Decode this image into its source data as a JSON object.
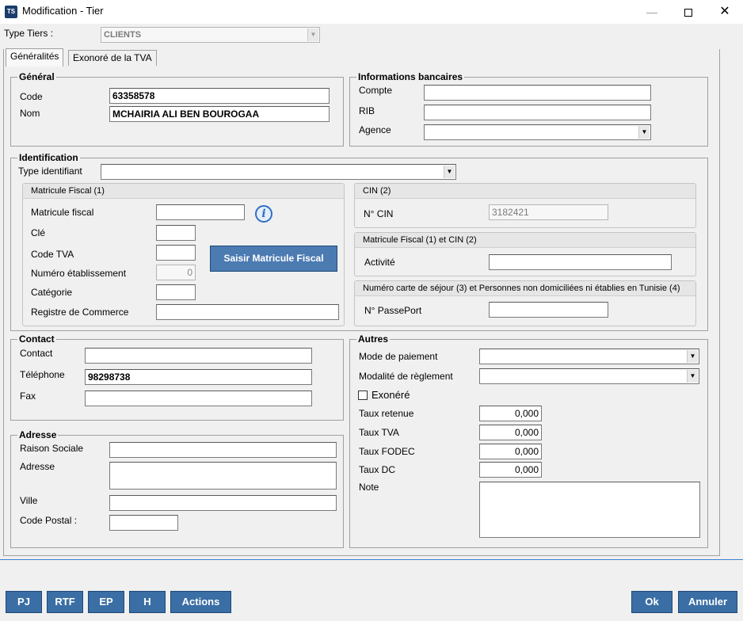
{
  "window": {
    "title": "Modification - Tier",
    "app_icon_text": "TS",
    "minimize": "—",
    "close": "✕"
  },
  "type_tiers": {
    "label": "Type Tiers :",
    "value": "CLIENTS"
  },
  "tabs": [
    {
      "label": "Généralités",
      "active": true
    },
    {
      "label": "Exonoré de la TVA",
      "active": false
    }
  ],
  "general": {
    "title": "Général",
    "code_label": "Code",
    "code_value": "63358578",
    "nom_label": "Nom",
    "nom_value": "MCHAIRIA ALI BEN BOUROGAA"
  },
  "banque": {
    "title": "Informations bancaires",
    "compte_label": "Compte",
    "compte_value": "",
    "rib_label": "RIB",
    "rib_value": "",
    "agence_label": "Agence",
    "agence_value": ""
  },
  "identification": {
    "title": "Identification",
    "type_label": "Type identifiant",
    "type_value": "",
    "mf_panel": {
      "title": "Matricule Fiscal (1)",
      "matricule_label": "Matricule fiscal",
      "matricule_value": "",
      "cle_label": "Clé",
      "cle_value": "",
      "code_tva_label": "Code TVA",
      "code_tva_value": "",
      "num_etab_label": "Numéro établissement",
      "num_etab_value": "0",
      "categorie_label": "Catégorie",
      "categorie_value": "",
      "registre_label": "Registre de Commerce",
      "registre_value": "",
      "saisir_button": "Saisir Matricule Fiscal",
      "info_icon": "i"
    },
    "cin_panel": {
      "title": "CIN (2)",
      "ncin_label": "N° CIN",
      "ncin_value": "3182421"
    },
    "mf_cin_panel": {
      "title": "Matricule Fiscal (1) et CIN (2)",
      "activite_label": "Activité",
      "activite_value": ""
    },
    "sejour_panel": {
      "title": "Numéro carte de séjour (3) et Personnes non domiciliées ni établies en Tunisie (4)",
      "passeport_label": "N° PassePort",
      "passeport_value": ""
    }
  },
  "contact": {
    "title": "Contact",
    "contact_label": "Contact",
    "contact_value": "",
    "tel_label": "Téléphone",
    "tel_value": "98298738",
    "fax_label": "Fax",
    "fax_value": ""
  },
  "autres": {
    "title": "Autres",
    "mode_label": "Mode de paiement",
    "mode_value": "",
    "modalite_label": "Modalité de règlement",
    "modalite_value": "",
    "exonere_label": "Exonéré",
    "exonere_checked": false,
    "retenue_label": "Taux retenue",
    "retenue_value": "0,000",
    "tva_label": "Taux TVA",
    "tva_value": "0,000",
    "fodec_label": "Taux FODEC",
    "fodec_value": "0,000",
    "dc_label": "Taux DC",
    "dc_value": "0,000",
    "note_label": "Note",
    "note_value": ""
  },
  "adresse": {
    "title": "Adresse",
    "raison_label": "Raison Sociale",
    "raison_value": "",
    "adresse_label": "Adresse",
    "adresse_value": "",
    "ville_label": "Ville",
    "ville_value": "",
    "cp_label": "Code Postal :",
    "cp_value": ""
  },
  "buttons": {
    "pj": "PJ",
    "rtf": "RTF",
    "ep": "EP",
    "h": "H",
    "actions": "Actions",
    "ok": "Ok",
    "annuler": "Annuler"
  },
  "colors": {
    "button_blue": "#3a6ea5",
    "separator": "#3c7fd0"
  },
  "icons": {
    "dropdown": "▼"
  }
}
